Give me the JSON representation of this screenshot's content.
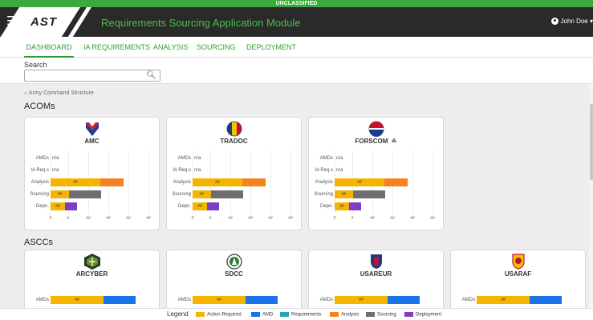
{
  "banner": "UNCLASSIFIED",
  "header": {
    "logo": "AST",
    "title": "Requirements Sourcing Application Module",
    "user": "John Doe"
  },
  "nav": [
    "DASHBOARD",
    "IA REQUIREMENTS",
    "ANALYSIS",
    "SOURCING",
    "DEPLOYMENT"
  ],
  "search": {
    "label": "Search",
    "value": "",
    "placeholder": ""
  },
  "breadcrumb": "Army Command Structure",
  "sections": {
    "acoms": "ACOMs",
    "asccs": "ASCCs"
  },
  "row_labels": [
    "AMDs",
    "IA Req.s",
    "Analysis",
    "Sourcing",
    "Depn."
  ],
  "na_text": "n/a",
  "bar_text": "##",
  "x_ticks": [
    "0",
    "#",
    "##",
    "##",
    "##",
    "##"
  ],
  "acoms": [
    {
      "name": "AMC",
      "icon": "amc-insignia-icon"
    },
    {
      "name": "TRADOC",
      "icon": "tradoc-insignia-icon"
    },
    {
      "name": "FORSCOM",
      "suffix": "☘",
      "icon": "forscom-insignia-icon"
    }
  ],
  "asccs": [
    {
      "name": "ARCYBER",
      "icon": "arcyber-insignia-icon"
    },
    {
      "name": "SDCC",
      "icon": "sdcc-insignia-icon"
    },
    {
      "name": "USAREUR",
      "icon": "usareur-insignia-icon"
    },
    {
      "name": "USARAF",
      "icon": "usaraf-insignia-icon"
    }
  ],
  "legend": {
    "title": "Legend",
    "items": [
      {
        "label": "Action Required",
        "color": "#f5b400"
      },
      {
        "label": "AMD",
        "color": "#1a73e8"
      },
      {
        "label": "Requirements",
        "color": "#26a5b5"
      },
      {
        "label": "Analysis",
        "color": "#f58220"
      },
      {
        "label": "Sourcing",
        "color": "#6d6e71"
      },
      {
        "label": "Deployment",
        "color": "#7e3fc2"
      }
    ]
  },
  "colors": {
    "action": "#f5b400",
    "amd": "#1a73e8",
    "requirements": "#26a5b5",
    "analysis": "#f58220",
    "sourcing": "#6d6e71",
    "deployment": "#7e3fc2",
    "accent": "#2e9e2e"
  }
}
